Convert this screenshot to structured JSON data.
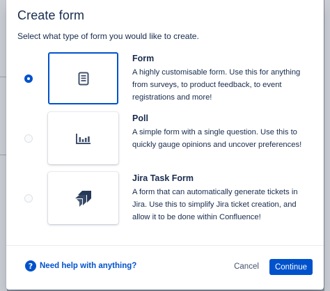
{
  "dialog": {
    "title": "Create form",
    "subtitle": "Select what type of form you would like to create."
  },
  "options": [
    {
      "title": "Form",
      "description": "A highly customisable form. Use this for anything from surveys, to product feedback, to event registrations and more!",
      "icon": "form-document-icon",
      "selected": true
    },
    {
      "title": "Poll",
      "description": "A simple form with a single question. Use this to quickly gauge opinions and uncover preferences!",
      "icon": "poll-bar-chart-icon",
      "selected": false
    },
    {
      "title": "Jira Task Form",
      "description": "A form that can automatically generate tickets in Jira. Use this to simplify Jira ticket creation, and allow it to be done within Confluence!",
      "icon": "jira-logo-icon",
      "selected": false
    }
  ],
  "footer": {
    "help_label": "Need help with anything?",
    "cancel_label": "Cancel",
    "continue_label": "Continue"
  },
  "colors": {
    "primary": "#0052cc",
    "text": "#172b4d",
    "jira_dark": "#253858"
  }
}
